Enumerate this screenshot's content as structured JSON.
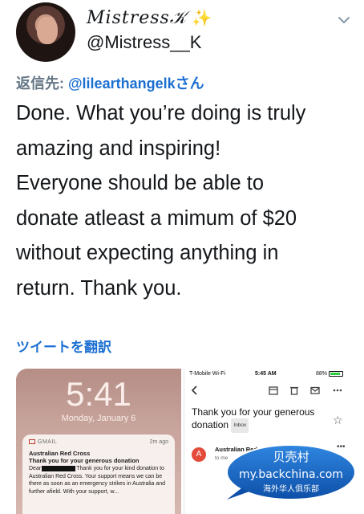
{
  "author": {
    "display_name": "𝑀𝑖𝑠𝑡𝑟𝑒𝑠𝑠𝒦",
    "sparkle": "✨",
    "handle": "@Mistress__K"
  },
  "reply": {
    "prefix": "返信先: ",
    "mention": "@lilearthangelkさん"
  },
  "tweet": {
    "lines": [
      "Done. What you’re doing is truly",
      "amazing and inspiring!",
      "Everyone should be able to",
      "donate atleast a mimum of $20",
      "without expecting anything in",
      "return. Thank you."
    ]
  },
  "translate_label": "ツイートを翻訳",
  "media_left": {
    "time": "5:41",
    "date": "Monday, January 6",
    "notification": {
      "app": "GMAIL",
      "time": "2m ago",
      "title": "Australian Red Cross",
      "subject": "Thank you for your generous donation",
      "body_prefix": "Dear",
      "body": "Thank you for your kind donation to Australian Red Cross. Your support means we can be there as soon as an emergency strikes in Australia and further afield. With your support, w..."
    }
  },
  "media_right": {
    "status": {
      "carrier": "T-Mobile Wi-Fi",
      "time": "5:45 AM",
      "battery": "88%",
      "battery_level": 0.88
    },
    "subject": "Thank you for your generous donation",
    "inbox_badge": "Inbox",
    "sender_initial": "A",
    "sender": "Australian Red Cross",
    "to": "to me"
  },
  "watermark": {
    "line1": "贝壳村",
    "line2": "my.backchina.com",
    "line3": "海外华人俱乐部"
  },
  "icons": {
    "chevron": "chevron-down-icon",
    "back": "back-arrow-icon",
    "archive": "archive-icon",
    "trash": "trash-icon",
    "mail": "mail-icon",
    "more": "more-icon",
    "star": "star-icon"
  },
  "colors": {
    "link": "#1b6fd1",
    "muted": "#657786",
    "watermark_blue": "#1565c0"
  }
}
